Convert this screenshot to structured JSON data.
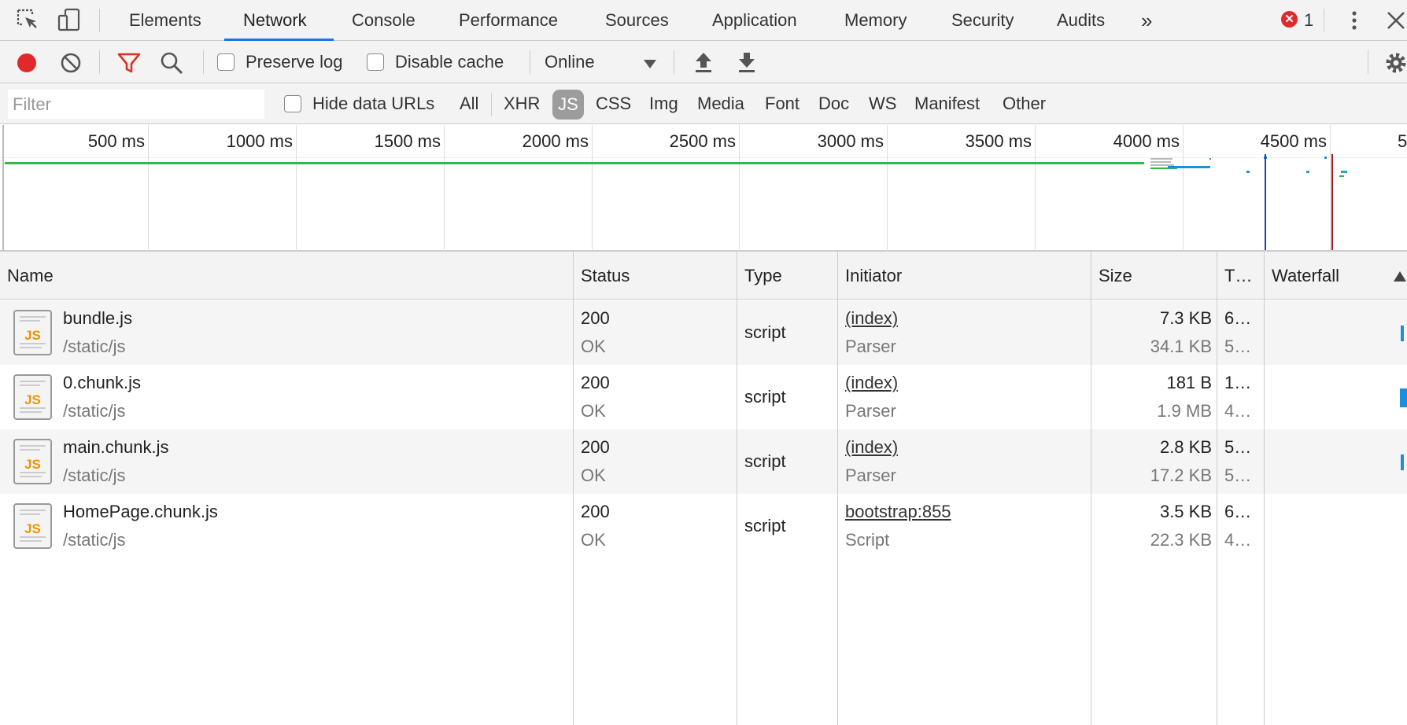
{
  "tabs": {
    "items": [
      {
        "label": "Elements"
      },
      {
        "label": "Network"
      },
      {
        "label": "Console"
      },
      {
        "label": "Performance"
      },
      {
        "label": "Sources"
      },
      {
        "label": "Application"
      },
      {
        "label": "Memory"
      },
      {
        "label": "Security"
      },
      {
        "label": "Audits"
      }
    ],
    "active": "Network",
    "more_icon": "chevron-double-right-icon",
    "error_count": "1"
  },
  "toolbar": {
    "preserve_log_label": "Preserve log",
    "disable_cache_label": "Disable cache",
    "throttling_value": "Online",
    "record_color": "#e0292b",
    "filter_icon_color": "#d93025"
  },
  "filterbar": {
    "filter_placeholder": "Filter",
    "hide_data_urls_label": "Hide data URLs",
    "types": [
      "All",
      "XHR",
      "JS",
      "CSS",
      "Img",
      "Media",
      "Font",
      "Doc",
      "WS",
      "Manifest",
      "Other"
    ],
    "selected_type": "JS"
  },
  "overview": {
    "tick_labels": [
      "500 ms",
      "1000 ms",
      "1500 ms",
      "2000 ms",
      "2500 ms",
      "3000 ms",
      "3500 ms",
      "4000 ms",
      "4500 ms",
      "5"
    ],
    "dom_content_loaded_color": "#1a73e8",
    "load_color": "#a31515"
  },
  "table": {
    "headers": {
      "name": "Name",
      "status": "Status",
      "type": "Type",
      "initiator": "Initiator",
      "size": "Size",
      "time": "T…",
      "waterfall": "Waterfall"
    },
    "rows": [
      {
        "name": "bundle.js",
        "path": "/static/js",
        "status": "200",
        "status_text": "OK",
        "type": "script",
        "initiator": "(index)",
        "initiator_sub": "Parser",
        "size": "7.3 KB",
        "size_sub": "34.1 KB",
        "time": "6…",
        "time_sub": "5…"
      },
      {
        "name": "0.chunk.js",
        "path": "/static/js",
        "status": "200",
        "status_text": "OK",
        "type": "script",
        "initiator": "(index)",
        "initiator_sub": "Parser",
        "size": "181 B",
        "size_sub": "1.9 MB",
        "time": "1…",
        "time_sub": "4…"
      },
      {
        "name": "main.chunk.js",
        "path": "/static/js",
        "status": "200",
        "status_text": "OK",
        "type": "script",
        "initiator": "(index)",
        "initiator_sub": "Parser",
        "size": "2.8 KB",
        "size_sub": "17.2 KB",
        "time": "5…",
        "time_sub": "5…"
      },
      {
        "name": "HomePage.chunk.js",
        "path": "/static/js",
        "status": "200",
        "status_text": "OK",
        "type": "script",
        "initiator": "bootstrap:855",
        "initiator_sub": "Script",
        "size": "3.5 KB",
        "size_sub": "22.3 KB",
        "time": "6…",
        "time_sub": "4…"
      }
    ],
    "file_icon_text": "JS"
  }
}
